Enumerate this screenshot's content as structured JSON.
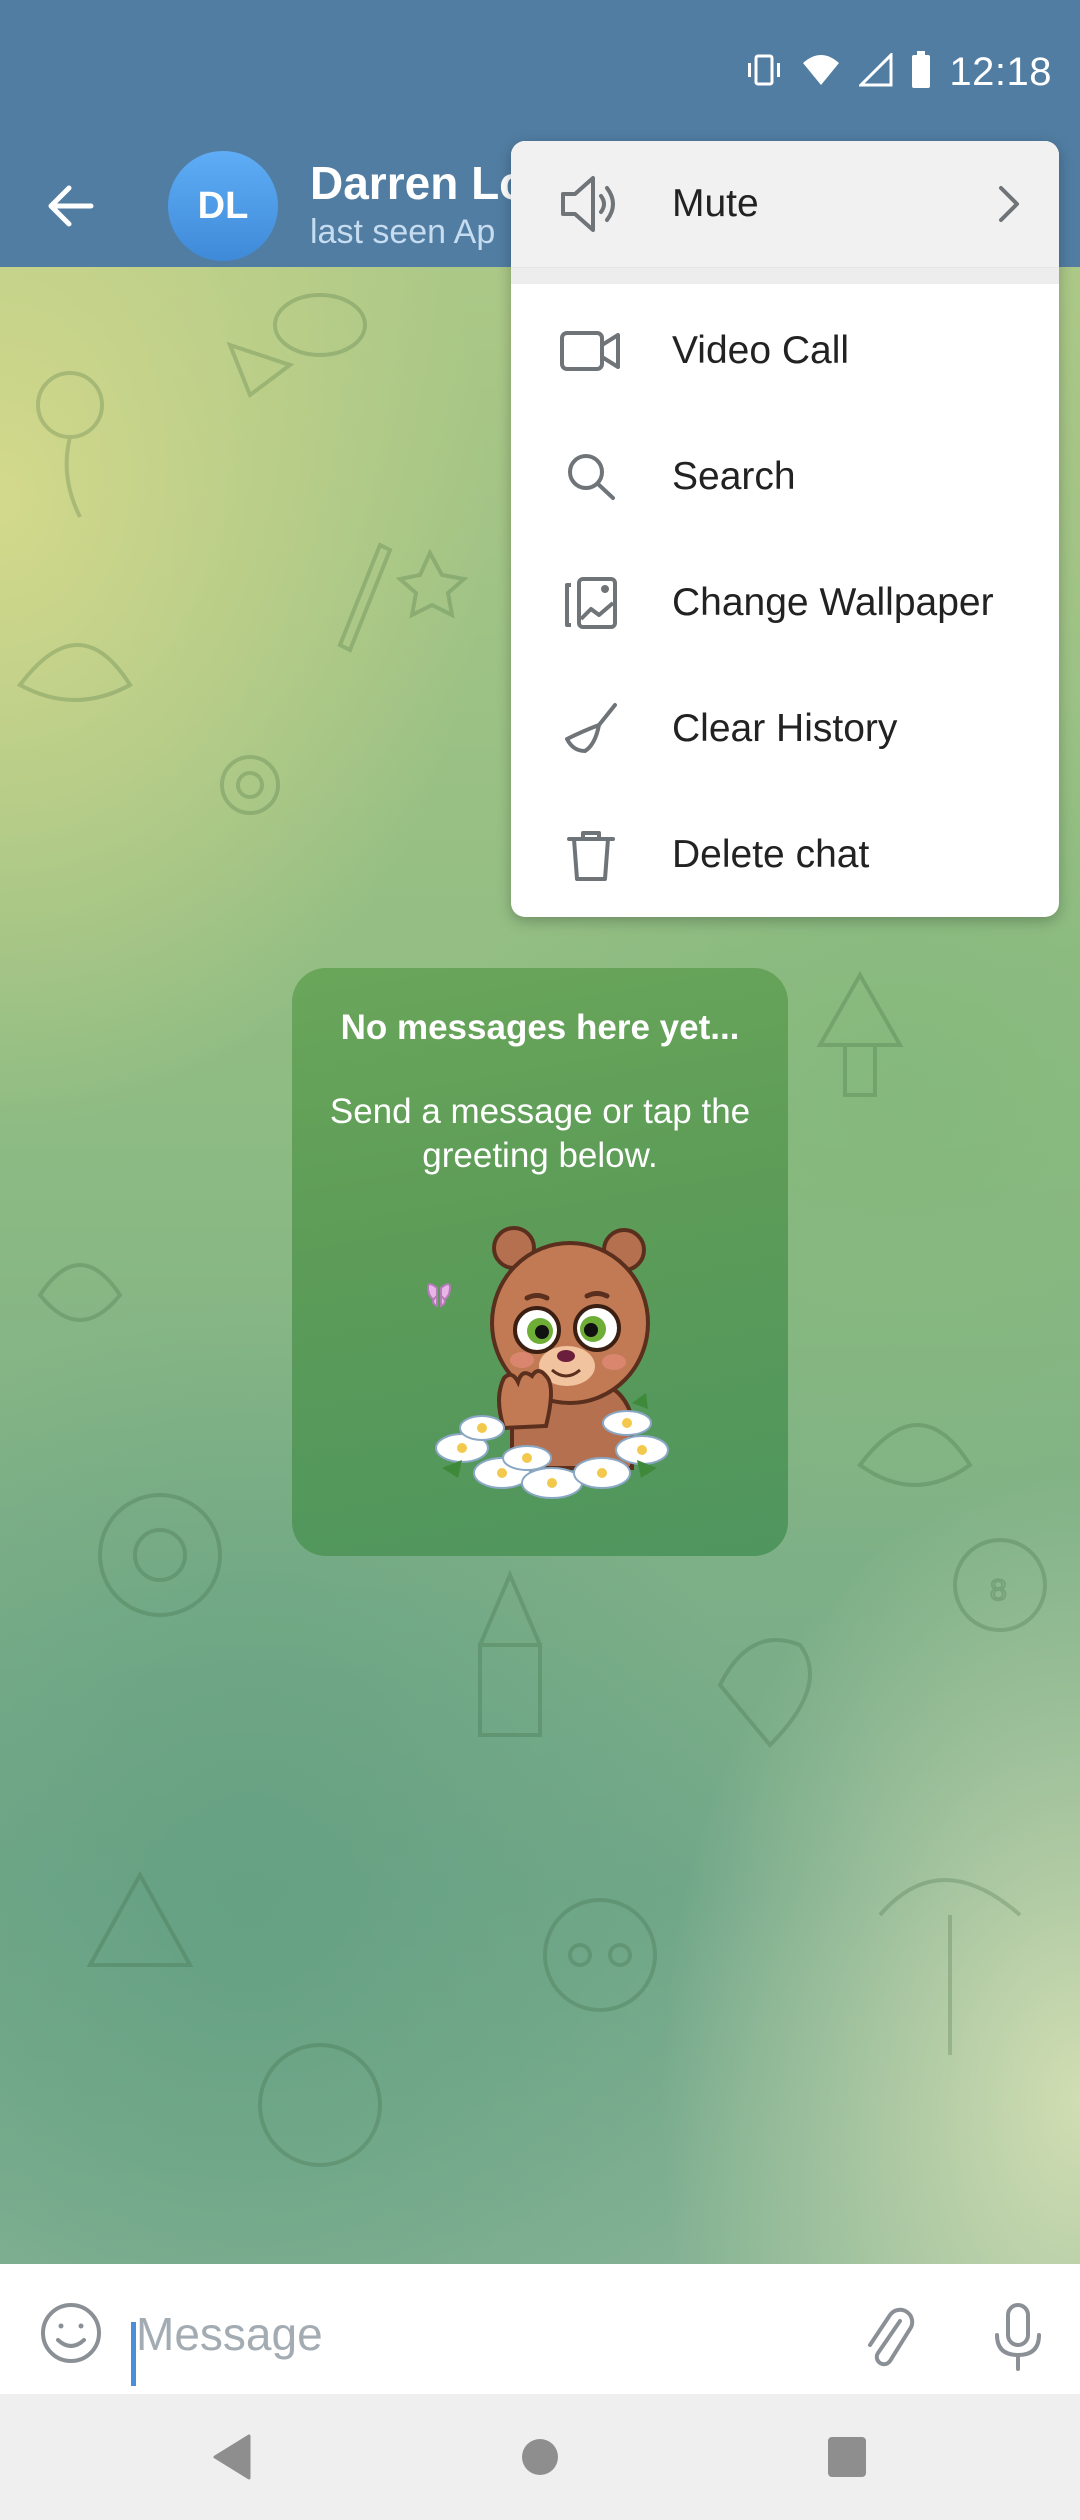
{
  "status_bar": {
    "time": "12:18",
    "icons": [
      "vibrate-icon",
      "wifi-icon",
      "cell-signal-icon",
      "battery-icon"
    ]
  },
  "header": {
    "back_icon": "arrow-left-icon",
    "avatar_initials": "DL",
    "avatar_color": "#4a9be8",
    "chat_name": "Darren Lo",
    "chat_status": "last seen Ap",
    "background_color": "#517da2"
  },
  "menu": {
    "items": [
      {
        "label": "Mute",
        "icon": "speaker-icon",
        "has_submenu": true
      },
      {
        "label": "Video Call",
        "icon": "video-camera-icon"
      },
      {
        "label": "Search",
        "icon": "search-icon"
      },
      {
        "label": "Change Wallpaper",
        "icon": "wallpaper-icon"
      },
      {
        "label": "Clear History",
        "icon": "broom-icon"
      },
      {
        "label": "Delete chat",
        "icon": "trash-icon"
      }
    ]
  },
  "empty_state": {
    "title": "No messages here yet...",
    "subtitle": "Send a message or tap the greeting below.",
    "sticker": "waving-bear-in-daisies-sticker"
  },
  "composer": {
    "placeholder": "Message",
    "value": "",
    "emoji_icon": "smiley-icon",
    "attach_icon": "paperclip-icon",
    "mic_icon": "microphone-icon"
  },
  "nav_bar": {
    "back": "nav-back-icon",
    "home": "nav-home-icon",
    "recents": "nav-recents-icon"
  }
}
